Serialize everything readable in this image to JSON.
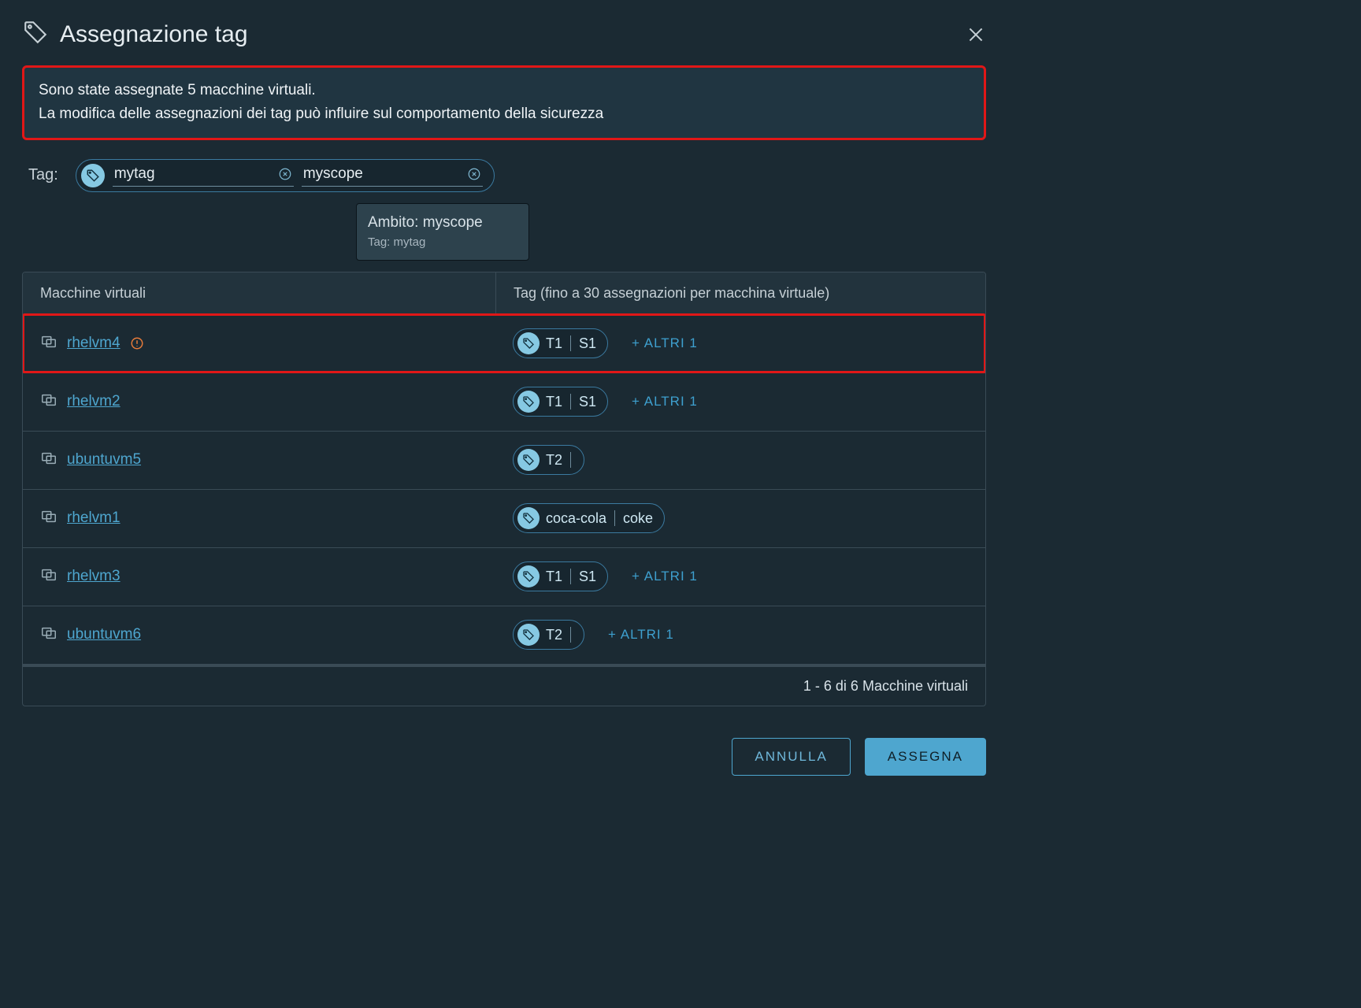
{
  "dialog": {
    "title": "Assegnazione tag",
    "warning_line1": "Sono state assegnate 5 macchine virtuali.",
    "warning_line2": "La modifica delle assegnazioni dei tag può influire sul comportamento della sicurezza"
  },
  "tag_input": {
    "label": "Tag:",
    "tag_value": "mytag",
    "scope_value": "myscope"
  },
  "tooltip": {
    "scope_label": "Ambito: myscope",
    "tag_label": "Tag: mytag"
  },
  "table": {
    "header_vm": "Macchine virtuali",
    "header_tags": "Tag (fino a 30 assegnazioni per macchina virtuale)",
    "rows": [
      {
        "name": "rhelvm4",
        "warn": true,
        "highlight": true,
        "chip": {
          "a": "T1",
          "b": "S1"
        },
        "more": "+ ALTRI 1"
      },
      {
        "name": "rhelvm2",
        "warn": false,
        "highlight": false,
        "chip": {
          "a": "T1",
          "b": "S1"
        },
        "more": "+ ALTRI 1"
      },
      {
        "name": "ubuntuvm5",
        "warn": false,
        "highlight": false,
        "chip": {
          "a": "T2",
          "b": ""
        },
        "more": ""
      },
      {
        "name": "rhelvm1",
        "warn": false,
        "highlight": false,
        "chip": {
          "a": "coca-cola",
          "b": "coke"
        },
        "more": ""
      },
      {
        "name": "rhelvm3",
        "warn": false,
        "highlight": false,
        "chip": {
          "a": "T1",
          "b": "S1"
        },
        "more": "+ ALTRI 1"
      },
      {
        "name": "ubuntuvm6",
        "warn": false,
        "highlight": false,
        "chip": {
          "a": "T2",
          "b": ""
        },
        "more": "+ ALTRI 1"
      }
    ],
    "footer": "1 - 6 di 6 Macchine virtuali"
  },
  "actions": {
    "cancel": "ANNULLA",
    "assign": "ASSEGNA"
  }
}
